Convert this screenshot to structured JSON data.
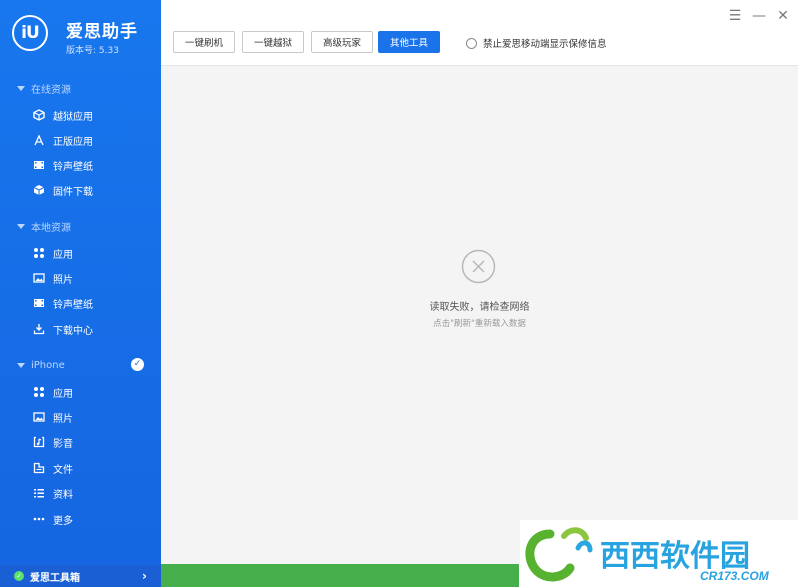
{
  "app": {
    "name": "爱思助手",
    "version": "版本号: 5.33",
    "logo_text": "iU"
  },
  "window_controls": {
    "menu": "☰",
    "minimize": "—",
    "close": "✕"
  },
  "toolbar": {
    "buttons": [
      {
        "label": "一键刷机",
        "active": false
      },
      {
        "label": "一键越狱",
        "active": false
      },
      {
        "label": "高级玩家",
        "active": false
      },
      {
        "label": "其他工具",
        "active": true
      }
    ],
    "warranty_label": "禁止爱思移动端显示保修信息"
  },
  "sidebar": {
    "online": {
      "title": "在线资源",
      "items": [
        {
          "label": "越狱应用",
          "icon": "box-icon"
        },
        {
          "label": "正版应用",
          "icon": "app-store-icon"
        },
        {
          "label": "铃声壁纸",
          "icon": "film-icon"
        },
        {
          "label": "固件下载",
          "icon": "cube-icon"
        }
      ]
    },
    "local": {
      "title": "本地资源",
      "items": [
        {
          "label": "应用",
          "icon": "grid-icon"
        },
        {
          "label": "照片",
          "icon": "photo-icon"
        },
        {
          "label": "铃声壁纸",
          "icon": "film-icon"
        },
        {
          "label": "下载中心",
          "icon": "download-icon"
        }
      ]
    },
    "iphone": {
      "title": "iPhone",
      "items": [
        {
          "label": "应用",
          "icon": "grid-icon"
        },
        {
          "label": "照片",
          "icon": "photo-icon"
        },
        {
          "label": "影音",
          "icon": "music-icon"
        },
        {
          "label": "文件",
          "icon": "file-icon"
        },
        {
          "label": "资料",
          "icon": "list-icon"
        },
        {
          "label": "更多",
          "icon": "more-icon"
        }
      ]
    },
    "toolbox_label": "爱思工具箱"
  },
  "content": {
    "error_title": "读取失败，请检查网络",
    "error_subtitle": "点击\"刷新\"重新载入数据"
  },
  "watermark": {
    "brand": "西西软件园",
    "url": "CR173.COM"
  },
  "colors": {
    "sidebar": "#1669e6",
    "accent": "#1a73e8",
    "bottom_bar": "#46ae4b",
    "content_bg": "#f4f4f4"
  }
}
